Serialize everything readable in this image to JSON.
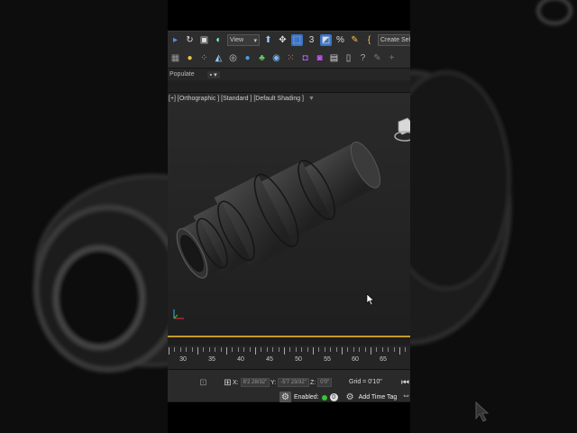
{
  "toolbar": {
    "view_select": "View",
    "create_selection": "Create Selectio",
    "row1_icons": [
      "link-icon",
      "refresh-icon",
      "select-region-icon",
      "material-icon",
      "view-dropdown",
      "select-object-icon",
      "move-icon",
      "select-tool-icon",
      "angle-snap-icon",
      "percent-snap-icon",
      "spinner-snap-icon",
      "named-selection-icon"
    ],
    "row2_icons": [
      "grid-icon",
      "sphere-icon",
      "dots-icon",
      "cone-icon",
      "circle-icon",
      "sphere-blue-icon",
      "creature-icon",
      "globe-icon",
      "particles-icon",
      "render-icon",
      "teapot-icon",
      "box-icon",
      "help-icon",
      "pin-icon",
      "plus-icon"
    ]
  },
  "ribbon": {
    "populate_tab": "Populate",
    "mini_button": "▪ ▾"
  },
  "viewport": {
    "label": "[+] [Orthographic ] [Standard ] [Default Shading ]"
  },
  "ruler": {
    "labels": [
      "30",
      "35",
      "40",
      "45",
      "50",
      "55",
      "60",
      "65"
    ]
  },
  "status": {
    "x_label": "X:",
    "x_value": "8'2 28/32\"",
    "y_label": "Y:",
    "y_value": "-5'7 23/32\"",
    "z_label": "Z:",
    "z_value": "0'0\"",
    "grid": "Grid = 0'10\"",
    "enabled_label": "Enabled:",
    "add_time_tag": "Add Time Tag"
  },
  "colors": {
    "accent": "#3b74c5",
    "timeslider": "#c59a2a",
    "enabled_green": "#32c832"
  }
}
